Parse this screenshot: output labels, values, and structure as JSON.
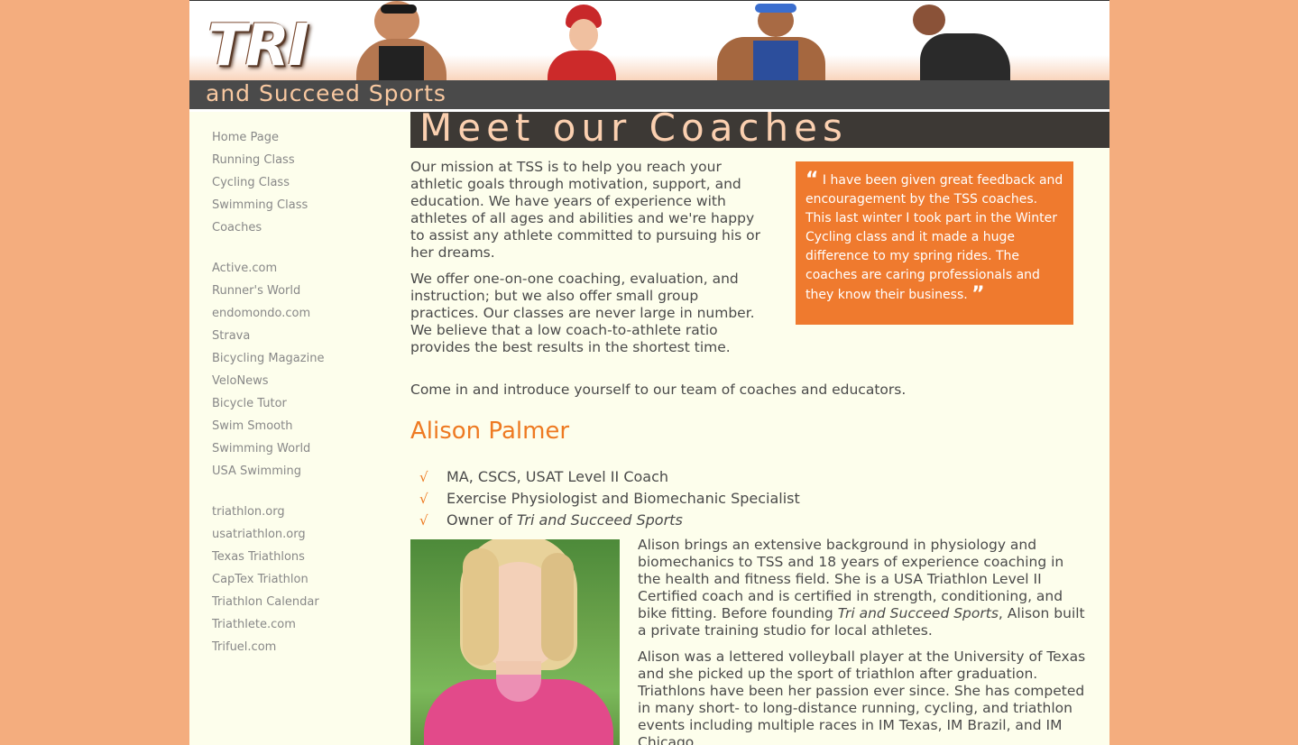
{
  "header": {
    "logo_tri": "TRI",
    "logo_sub": "and Succeed Sports"
  },
  "sidebar": {
    "group1": [
      "Home Page",
      "Running Class",
      "Cycling Class",
      "Swimming Class",
      "Coaches"
    ],
    "group2": [
      "Active.com",
      "Runner's World",
      "endomondo.com",
      "Strava",
      "Bicycling Magazine",
      "VeloNews",
      "Bicycle Tutor",
      "Swim Smooth",
      "Swimming World",
      "USA Swimming"
    ],
    "group3": [
      "triathlon.org",
      "usatriathlon.org",
      "Texas Triathlons",
      "CapTex Triathlon",
      "Triathlon Calendar",
      "Triathlete.com",
      "Trifuel.com"
    ]
  },
  "main": {
    "title": "Meet our Coaches",
    "intro_p1": "Our mission at TSS is to help you reach your athletic goals through motivation, support, and education. We have years of experience with athletes of all ages and abilities and we're happy to assist any athlete committed to pursuing his or her dreams.",
    "intro_p2": "We offer one-on-one coaching, evaluation, and instruction; but we also offer small group practices. Our classes are never large in number. We believe that a low coach-to-athlete ratio provides the best results in the shortest time.",
    "come_in": "Come in and introduce yourself to our team of coaches and educators.",
    "quote": "I have been given great feedback and encouragement by the TSS coaches. This last winter I took part in the Winter Cycling class and it made a huge difference to my spring rides. The coaches are caring professionals and they know their business.",
    "coach": {
      "name": "Alison Palmer",
      "cred1": "MA, CSCS, USAT Level II Coach",
      "cred2": "Exercise Physiologist and Biomechanic Specialist",
      "cred3_prefix": "Owner of ",
      "cred3_em": "Tri and Succeed Sports",
      "bio1_a": "Alison brings an extensive background in physiology and biomechanics to TSS and 18 years of experience coaching in the health and fitness field. She is a USA Triathlon Level II Certified coach and is certified in strength, conditioning, and bike fitting. Before founding ",
      "bio1_em": "Tri and Succeed Sports",
      "bio1_b": ", Alison built a private training studio for local athletes.",
      "bio2": "Alison was a lettered volleyball player at the University of Texas and she picked up the sport of triathlon after graduation. Triathlons have been her passion ever since. She has competed in many short- to long-distance running, cycling, and triathlon events including multiple races in IM Texas, IM Brazil, and IM Chicago."
    }
  },
  "colors": {
    "background": "#f4ad7e",
    "accent": "#ee7a22",
    "content_bg": "#fdfeec",
    "title_bar": "#3d3935"
  },
  "icons": {
    "checkmark": "check-icon"
  }
}
